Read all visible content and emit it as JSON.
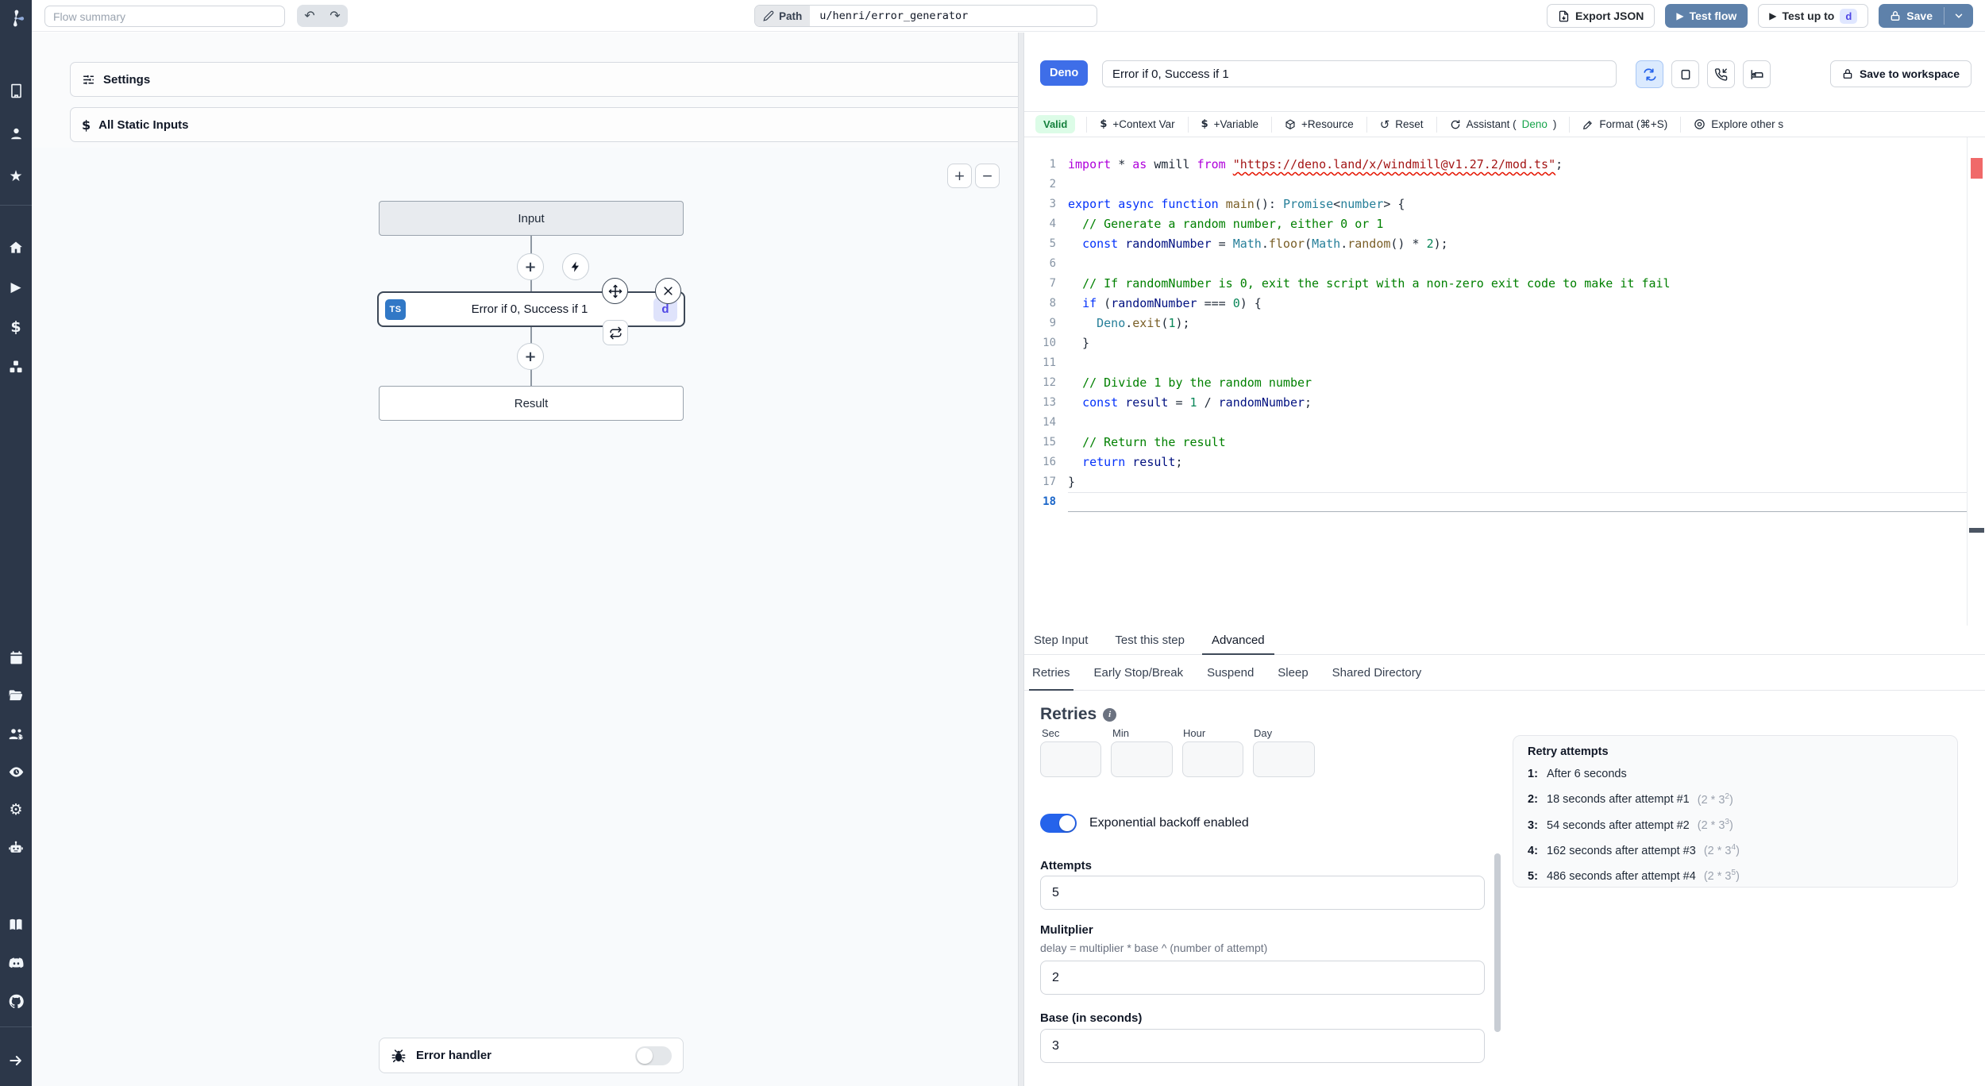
{
  "topbar": {
    "flow_summary_placeholder": "Flow summary",
    "path_label": "Path",
    "path_value": "u/henri/error_generator",
    "export_json_label": "Export JSON",
    "test_flow_label": "Test flow",
    "test_up_to_label": "Test up to",
    "test_up_to_badge": "d",
    "save_label": "Save"
  },
  "icons": {
    "undo": "↶",
    "redo": "↷",
    "zoom_in": "+",
    "zoom_out": "−",
    "gear": "⚙",
    "star": "★",
    "play": "▶",
    "dollar": "$",
    "reset": "↺",
    "info": "i",
    "plus": "+",
    "close": "✕"
  },
  "flow": {
    "settings_label": "Settings",
    "static_inputs_label": "All Static Inputs",
    "input_node": "Input",
    "step_node": {
      "title": "Error if 0, Success if 1",
      "lang_badge": "TS",
      "id_badge": "d"
    },
    "result_node": "Result",
    "error_handler_label": "Error handler"
  },
  "editor": {
    "lang_badge": "Deno",
    "summary_value": "Error if 0, Success if 1",
    "save_to_workspace_label": "Save to workspace",
    "valid_badge": "Valid",
    "toolbar": {
      "context_var": "+Context Var",
      "variable": "+Variable",
      "resource": "+Resource",
      "reset": "Reset",
      "assistant_prefix": "Assistant (",
      "assistant_lang": "Deno",
      "assistant_suffix": ")",
      "format": "Format (⌘+S)",
      "explore": "Explore other s"
    },
    "active_line": 18,
    "code_lines": [
      {
        "n": 1,
        "t": [
          [
            "kw1",
            "import"
          ],
          [
            "pl",
            " * "
          ],
          [
            "kw1",
            "as"
          ],
          [
            "pl",
            " wmill "
          ],
          [
            "kw1",
            "from"
          ],
          [
            "pl",
            " "
          ],
          [
            "strerr",
            "\"https://deno.land/x/windmill@v1.27.2/mod.ts\""
          ],
          [
            "pl",
            ";"
          ]
        ]
      },
      {
        "n": 2,
        "t": []
      },
      {
        "n": 3,
        "t": [
          [
            "kw",
            "export"
          ],
          [
            "pl",
            " "
          ],
          [
            "kw",
            "async"
          ],
          [
            "pl",
            " "
          ],
          [
            "kw",
            "function"
          ],
          [
            "pl",
            " "
          ],
          [
            "fn",
            "main"
          ],
          [
            "pl",
            "(): "
          ],
          [
            "type",
            "Promise"
          ],
          [
            "pl",
            "<"
          ],
          [
            "type",
            "number"
          ],
          [
            "pl",
            "> {"
          ]
        ]
      },
      {
        "n": 4,
        "t": [
          [
            "pl",
            "  "
          ],
          [
            "com",
            "// Generate a random number, either 0 or 1"
          ]
        ]
      },
      {
        "n": 5,
        "t": [
          [
            "pl",
            "  "
          ],
          [
            "kw",
            "const"
          ],
          [
            "pl",
            " "
          ],
          [
            "var",
            "randomNumber"
          ],
          [
            "pl",
            " = "
          ],
          [
            "type",
            "Math"
          ],
          [
            "pl",
            "."
          ],
          [
            "fn",
            "floor"
          ],
          [
            "pl",
            "("
          ],
          [
            "type",
            "Math"
          ],
          [
            "pl",
            "."
          ],
          [
            "fn",
            "random"
          ],
          [
            "pl",
            "() * "
          ],
          [
            "num",
            "2"
          ],
          [
            "pl",
            ");"
          ]
        ]
      },
      {
        "n": 6,
        "t": []
      },
      {
        "n": 7,
        "t": [
          [
            "pl",
            "  "
          ],
          [
            "com",
            "// If randomNumber is 0, exit the script with a non-zero exit code to make it fail"
          ]
        ]
      },
      {
        "n": 8,
        "t": [
          [
            "pl",
            "  "
          ],
          [
            "kw",
            "if"
          ],
          [
            "pl",
            " ("
          ],
          [
            "var",
            "randomNumber"
          ],
          [
            "pl",
            " === "
          ],
          [
            "num",
            "0"
          ],
          [
            "pl",
            ") {"
          ]
        ]
      },
      {
        "n": 9,
        "t": [
          [
            "pl",
            "    "
          ],
          [
            "type",
            "Deno"
          ],
          [
            "pl",
            "."
          ],
          [
            "fn",
            "exit"
          ],
          [
            "pl",
            "("
          ],
          [
            "num",
            "1"
          ],
          [
            "pl",
            ");"
          ]
        ]
      },
      {
        "n": 10,
        "t": [
          [
            "pl",
            "  }"
          ]
        ]
      },
      {
        "n": 11,
        "t": []
      },
      {
        "n": 12,
        "t": [
          [
            "pl",
            "  "
          ],
          [
            "com",
            "// Divide 1 by the random number"
          ]
        ]
      },
      {
        "n": 13,
        "t": [
          [
            "pl",
            "  "
          ],
          [
            "kw",
            "const"
          ],
          [
            "pl",
            " "
          ],
          [
            "var",
            "result"
          ],
          [
            "pl",
            " = "
          ],
          [
            "num",
            "1"
          ],
          [
            "pl",
            " / "
          ],
          [
            "var",
            "randomNumber"
          ],
          [
            "pl",
            ";"
          ]
        ]
      },
      {
        "n": 14,
        "t": []
      },
      {
        "n": 15,
        "t": [
          [
            "pl",
            "  "
          ],
          [
            "com",
            "// Return the result"
          ]
        ]
      },
      {
        "n": 16,
        "t": [
          [
            "kw",
            "  return"
          ],
          [
            "var",
            " result"
          ],
          [
            "pl",
            ";"
          ]
        ]
      },
      {
        "n": 17,
        "t": [
          [
            "pl",
            "}"
          ]
        ]
      },
      {
        "n": 18,
        "t": []
      }
    ]
  },
  "panel": {
    "tabs": [
      "Step Input",
      "Test this step",
      "Advanced"
    ],
    "active_tab": "Advanced",
    "subtabs": [
      "Retries",
      "Early Stop/Break",
      "Suspend",
      "Sleep",
      "Shared Directory"
    ],
    "active_subtab": "Retries",
    "retries": {
      "title": "Retries",
      "time_labels": [
        "Sec",
        "Min",
        "Hour",
        "Day"
      ],
      "backoff_toggle_label": "Exponential backoff enabled",
      "attempts_label": "Attempts",
      "attempts_value": "5",
      "multiplier_label": "Mulitplier",
      "multiplier_help": "delay = multiplier * base ^ (number of attempt)",
      "multiplier_value": "2",
      "base_label": "Base (in seconds)",
      "base_value": "3",
      "card": {
        "title": "Retry attempts",
        "rows": [
          {
            "n": "1:",
            "text": "After 6 seconds",
            "formula": "",
            "exp": ""
          },
          {
            "n": "2:",
            "text": "18 seconds after attempt #1",
            "formula": "(2 * 3",
            "exp": "2"
          },
          {
            "n": "3:",
            "text": "54 seconds after attempt #2",
            "formula": "(2 * 3",
            "exp": "3"
          },
          {
            "n": "4:",
            "text": "162 seconds after attempt #3",
            "formula": "(2 * 3",
            "exp": "4"
          },
          {
            "n": "5:",
            "text": "486 seconds after attempt #4",
            "formula": "(2 * 3",
            "exp": "5"
          }
        ]
      }
    }
  },
  "colors": {
    "accent_button": "#5e81aa",
    "deno_badge": "#3e6ee8",
    "toggle_on": "#2563eb",
    "valid_bg": "#dcfce7",
    "valid_text": "#15803d",
    "sidebar_bg": "#2c3749"
  }
}
